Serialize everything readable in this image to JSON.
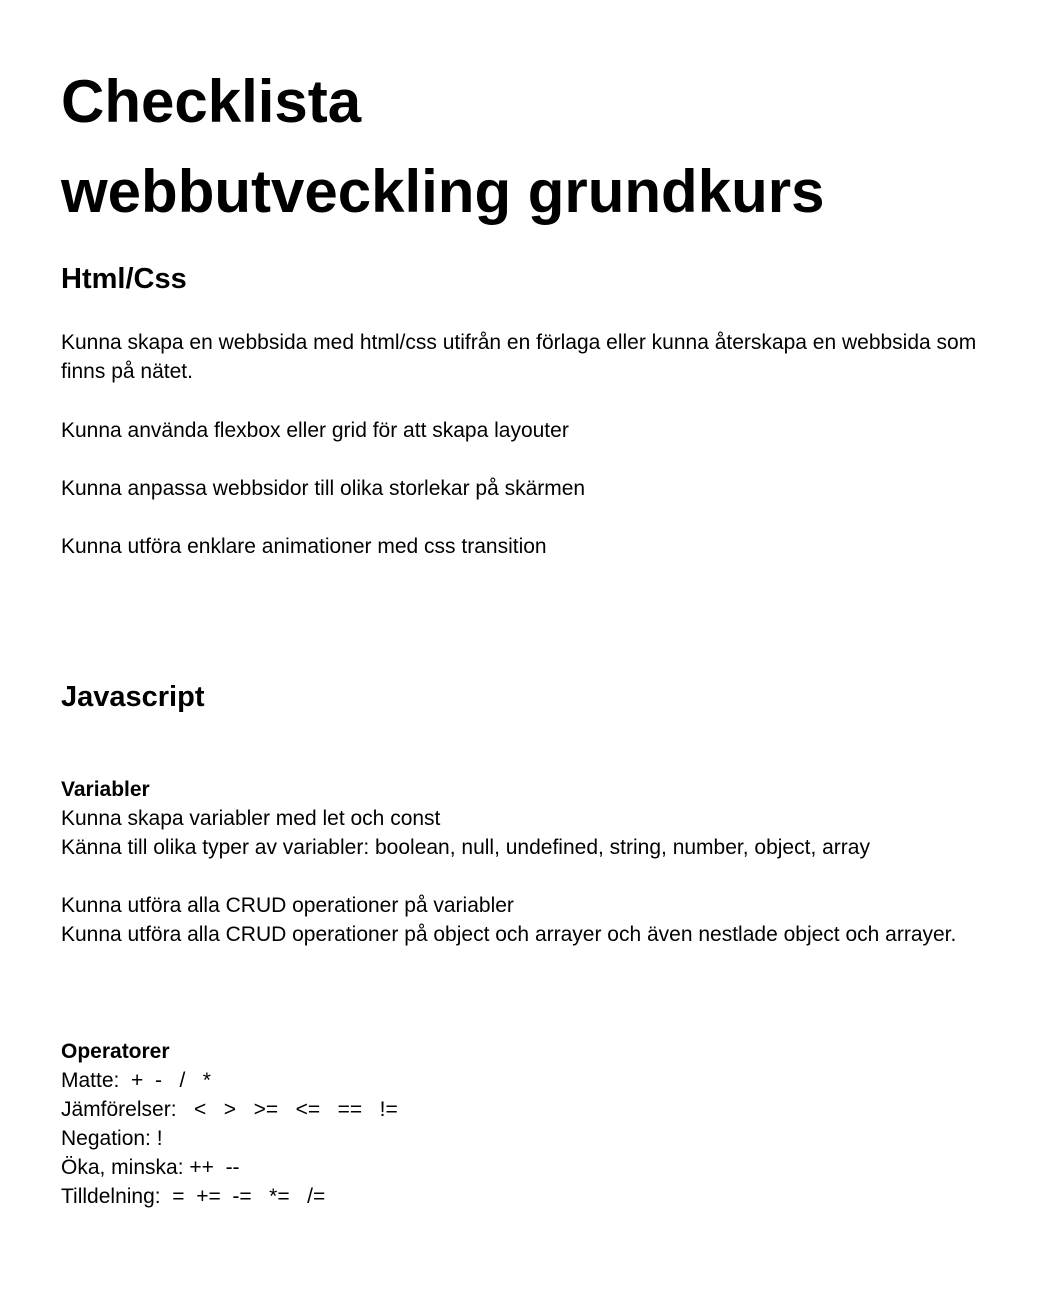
{
  "title": {
    "line1": "Checklista",
    "line2": "webbutveckling grundkurs"
  },
  "html_css": {
    "heading": "Html/Css",
    "items": [
      "Kunna skapa en webbsida med html/css utifrån en förlaga eller kunna återskapa en webbsida som finns på nätet.",
      "Kunna använda flexbox eller grid för att skapa layouter",
      "Kunna anpassa webbsidor till olika storlekar på skärmen",
      "Kunna utföra enklare animationer med css transition"
    ]
  },
  "javascript": {
    "heading": "Javascript",
    "variables": {
      "heading": "Variabler",
      "lines": [
        "Kunna skapa variabler med let och const",
        "Känna till olika typer av variabler: boolean, null, undefined, string, number, object, array"
      ],
      "crud_lines": [
        "Kunna utföra alla CRUD operationer på variabler",
        "Kunna utföra alla CRUD operationer på object och arrayer och även nestlade object och arrayer."
      ]
    },
    "operators": {
      "heading": "Operatorer",
      "lines": [
        "Matte:  +  -   /   *",
        "Jämförelser:   <   >   >=   <=   ==   !=",
        "Negation: !",
        "Öka, minska: ++  --",
        "Tilldelning:  =  +=  -=   *=   /="
      ]
    }
  }
}
